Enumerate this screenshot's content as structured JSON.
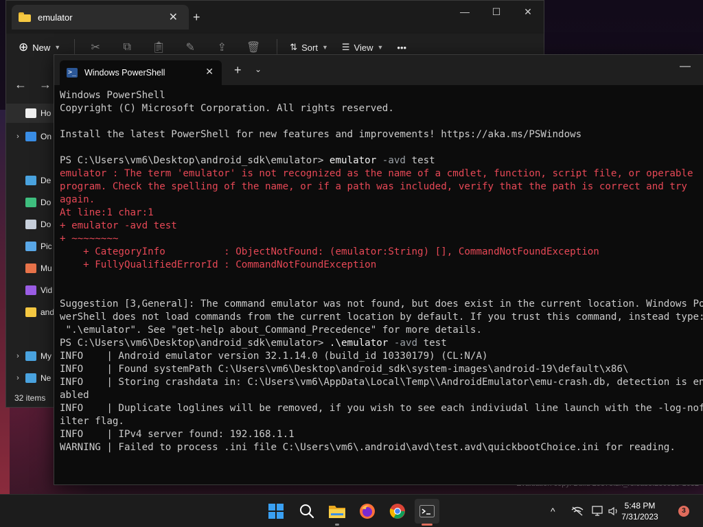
{
  "explorer": {
    "tab_title": "emulator",
    "new_tab_symbol": "+",
    "window_controls": {
      "minimize": "—",
      "maximize": "☐",
      "close": "✕"
    },
    "toolbar": {
      "new_label": "New",
      "sort_label": "Sort",
      "view_label": "View",
      "more_label": "•••"
    },
    "nav": {
      "back": "←",
      "forward": "→"
    },
    "sidebar": [
      {
        "label": "Ho",
        "expandable": false,
        "selected": true,
        "icon": "home-icon"
      },
      {
        "label": "On",
        "expandable": true,
        "icon": "onedrive-icon"
      },
      {
        "label": "De",
        "expandable": false,
        "icon": "desktop-icon"
      },
      {
        "label": "Do",
        "expandable": false,
        "icon": "downloads-icon"
      },
      {
        "label": "Do",
        "expandable": false,
        "icon": "documents-icon"
      },
      {
        "label": "Pic",
        "expandable": false,
        "icon": "pictures-icon"
      },
      {
        "label": "Mu",
        "expandable": false,
        "icon": "music-icon"
      },
      {
        "label": "Vid",
        "expandable": false,
        "icon": "videos-icon"
      },
      {
        "label": "and",
        "expandable": false,
        "icon": "folder-icon"
      },
      {
        "label": "My",
        "expandable": true,
        "icon": "pc-icon"
      },
      {
        "label": "Ne",
        "expandable": true,
        "icon": "network-icon"
      }
    ],
    "status": "32 items"
  },
  "terminal": {
    "tab_title": "Windows PowerShell",
    "new_tab_symbol": "+",
    "dropdown_symbol": "⌄",
    "minimize_symbol": "—",
    "lines": [
      [
        {
          "t": "Windows PowerShell",
          "c": "val"
        }
      ],
      [
        {
          "t": "Copyright (C) Microsoft Corporation. All rights reserved.",
          "c": "val"
        }
      ],
      [
        {
          "t": "",
          "c": "val"
        }
      ],
      [
        {
          "t": "Install the latest PowerShell for new features and improvements! https://aka.ms/PSWindows",
          "c": "val"
        }
      ],
      [
        {
          "t": "",
          "c": "val"
        }
      ],
      [
        {
          "t": "PS C:\\Users\\vm6\\Desktop\\android_sdk\\emulator> ",
          "c": "val"
        },
        {
          "t": "emulator",
          "c": "cmd"
        },
        {
          "t": " -avd",
          "c": "param"
        },
        {
          "t": " test",
          "c": "val"
        }
      ],
      [
        {
          "t": "emulator : The term 'emulator' is not recognized as the name of a cmdlet, function, script file, or operable",
          "c": "err"
        }
      ],
      [
        {
          "t": "program. Check the spelling of the name, or if a path was included, verify that the path is correct and try",
          "c": "err"
        }
      ],
      [
        {
          "t": "again.",
          "c": "err"
        }
      ],
      [
        {
          "t": "At line:1 char:1",
          "c": "err"
        }
      ],
      [
        {
          "t": "+ emulator -avd test",
          "c": "err"
        }
      ],
      [
        {
          "t": "+ ~~~~~~~~",
          "c": "err"
        }
      ],
      [
        {
          "t": "    + CategoryInfo          : ObjectNotFound: (emulator:String) [], CommandNotFoundException",
          "c": "err"
        }
      ],
      [
        {
          "t": "    + FullyQualifiedErrorId : CommandNotFoundException",
          "c": "err"
        }
      ],
      [
        {
          "t": "",
          "c": "val"
        }
      ],
      [
        {
          "t": "",
          "c": "val"
        }
      ],
      [
        {
          "t": "Suggestion [3,General]: The command emulator was not found, but does exist in the current location. Windows Po",
          "c": "val"
        }
      ],
      [
        {
          "t": "werShell does not load commands from the current location by default. If you trust this command, instead type:",
          "c": "val"
        }
      ],
      [
        {
          "t": " \".\\emulator\". See \"get-help about_Command_Precedence\" for more details.",
          "c": "val"
        }
      ],
      [
        {
          "t": "PS C:\\Users\\vm6\\Desktop\\android_sdk\\emulator> ",
          "c": "val"
        },
        {
          "t": ".\\emulator",
          "c": "cmd"
        },
        {
          "t": " -avd",
          "c": "param"
        },
        {
          "t": " test",
          "c": "val"
        }
      ],
      [
        {
          "t": "INFO    | Android emulator version 32.1.14.0 (build_id 10330179) (CL:N/A)",
          "c": "val"
        }
      ],
      [
        {
          "t": "INFO    | Found systemPath C:\\Users\\vm6\\Desktop\\android_sdk\\system-images\\android-19\\default\\x86\\",
          "c": "val"
        }
      ],
      [
        {
          "t": "INFO    | Storing crashdata in: C:\\Users\\vm6\\AppData\\Local\\Temp\\\\AndroidEmulator\\emu-crash.db, detection is en",
          "c": "val"
        }
      ],
      [
        {
          "t": "abled",
          "c": "val"
        }
      ],
      [
        {
          "t": "INFO    | Duplicate loglines will be removed, if you wish to see each indiviudal line launch with the -log-nof",
          "c": "val"
        }
      ],
      [
        {
          "t": "ilter flag.",
          "c": "val"
        }
      ],
      [
        {
          "t": "INFO    | IPv4 server found: 192.168.1.1",
          "c": "val"
        }
      ],
      [
        {
          "t": "WARNING | Failed to process .ini file C:\\Users\\vm6\\.android\\avd\\test.avd\\quickbootChoice.ini for reading.",
          "c": "val"
        }
      ]
    ]
  },
  "desktop": {
    "watermark": "Evaluation copy. Build 25375.zn_release.230520-1632"
  },
  "taskbar": {
    "apps": [
      "windows-start",
      "search",
      "file-explorer",
      "firefox",
      "chrome",
      "terminal"
    ],
    "time": "5:48 PM",
    "date": "7/31/2023",
    "notification_count": "3",
    "tray_chevron": "^"
  },
  "colors": {
    "error_red": "#e74856",
    "terminal_bg": "#0c0c0c",
    "taskbar_bg": "#1c1c1c",
    "folder_yellow": "#f5c842",
    "badge": "#e06c5c"
  }
}
